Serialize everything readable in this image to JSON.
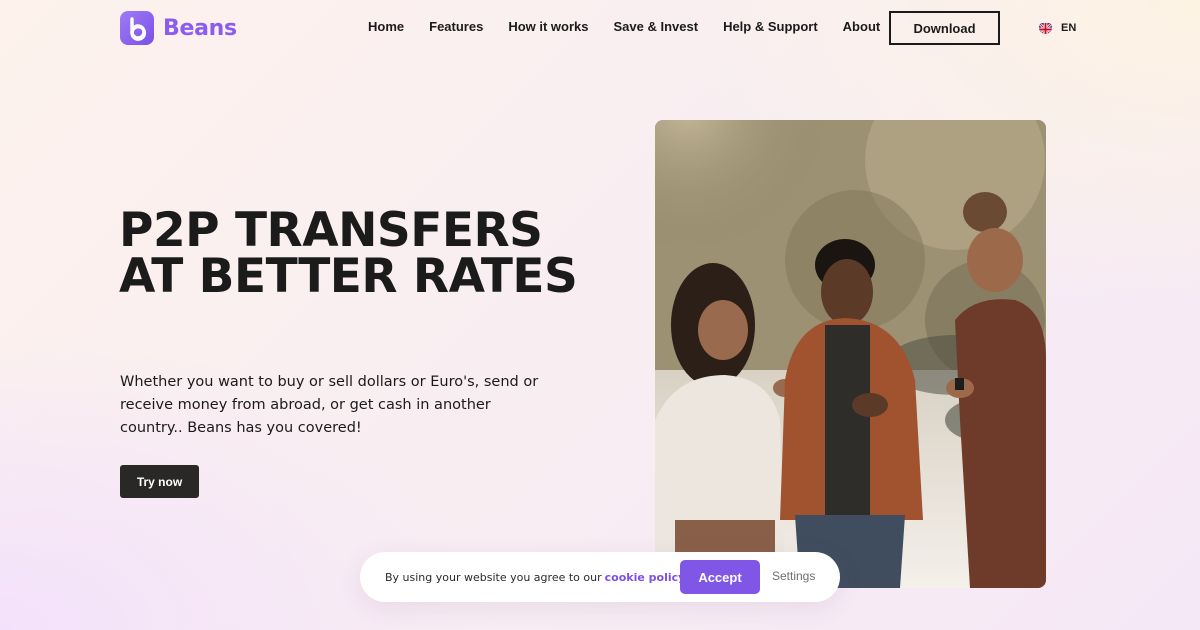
{
  "brand": {
    "name": "Beans",
    "accent_color": "#8b5cf0"
  },
  "nav": {
    "items": [
      {
        "label": "Home"
      },
      {
        "label": "Features"
      },
      {
        "label": "How it works"
      },
      {
        "label": "Save & Invest"
      },
      {
        "label": "Help & Support"
      },
      {
        "label": "About"
      }
    ],
    "download_label": "Download",
    "language": {
      "label": "EN",
      "icon": "uk-flag-icon"
    }
  },
  "hero": {
    "title": "P2P TRANSFERS AT BETTER RATES",
    "subtitle": "Whether you want to buy or sell dollars or Euro's, send or receive money from abroad, or get cash in another country.. Beans has you covered!",
    "cta_label": "Try now",
    "image_alt": "Three young people smiling while looking at their phones outdoors"
  },
  "cookie_banner": {
    "text": "By using your website you agree to our",
    "link_label": "cookie policy",
    "accept_label": "Accept",
    "settings_label": "Settings",
    "accept_color": "#7f56e6"
  }
}
